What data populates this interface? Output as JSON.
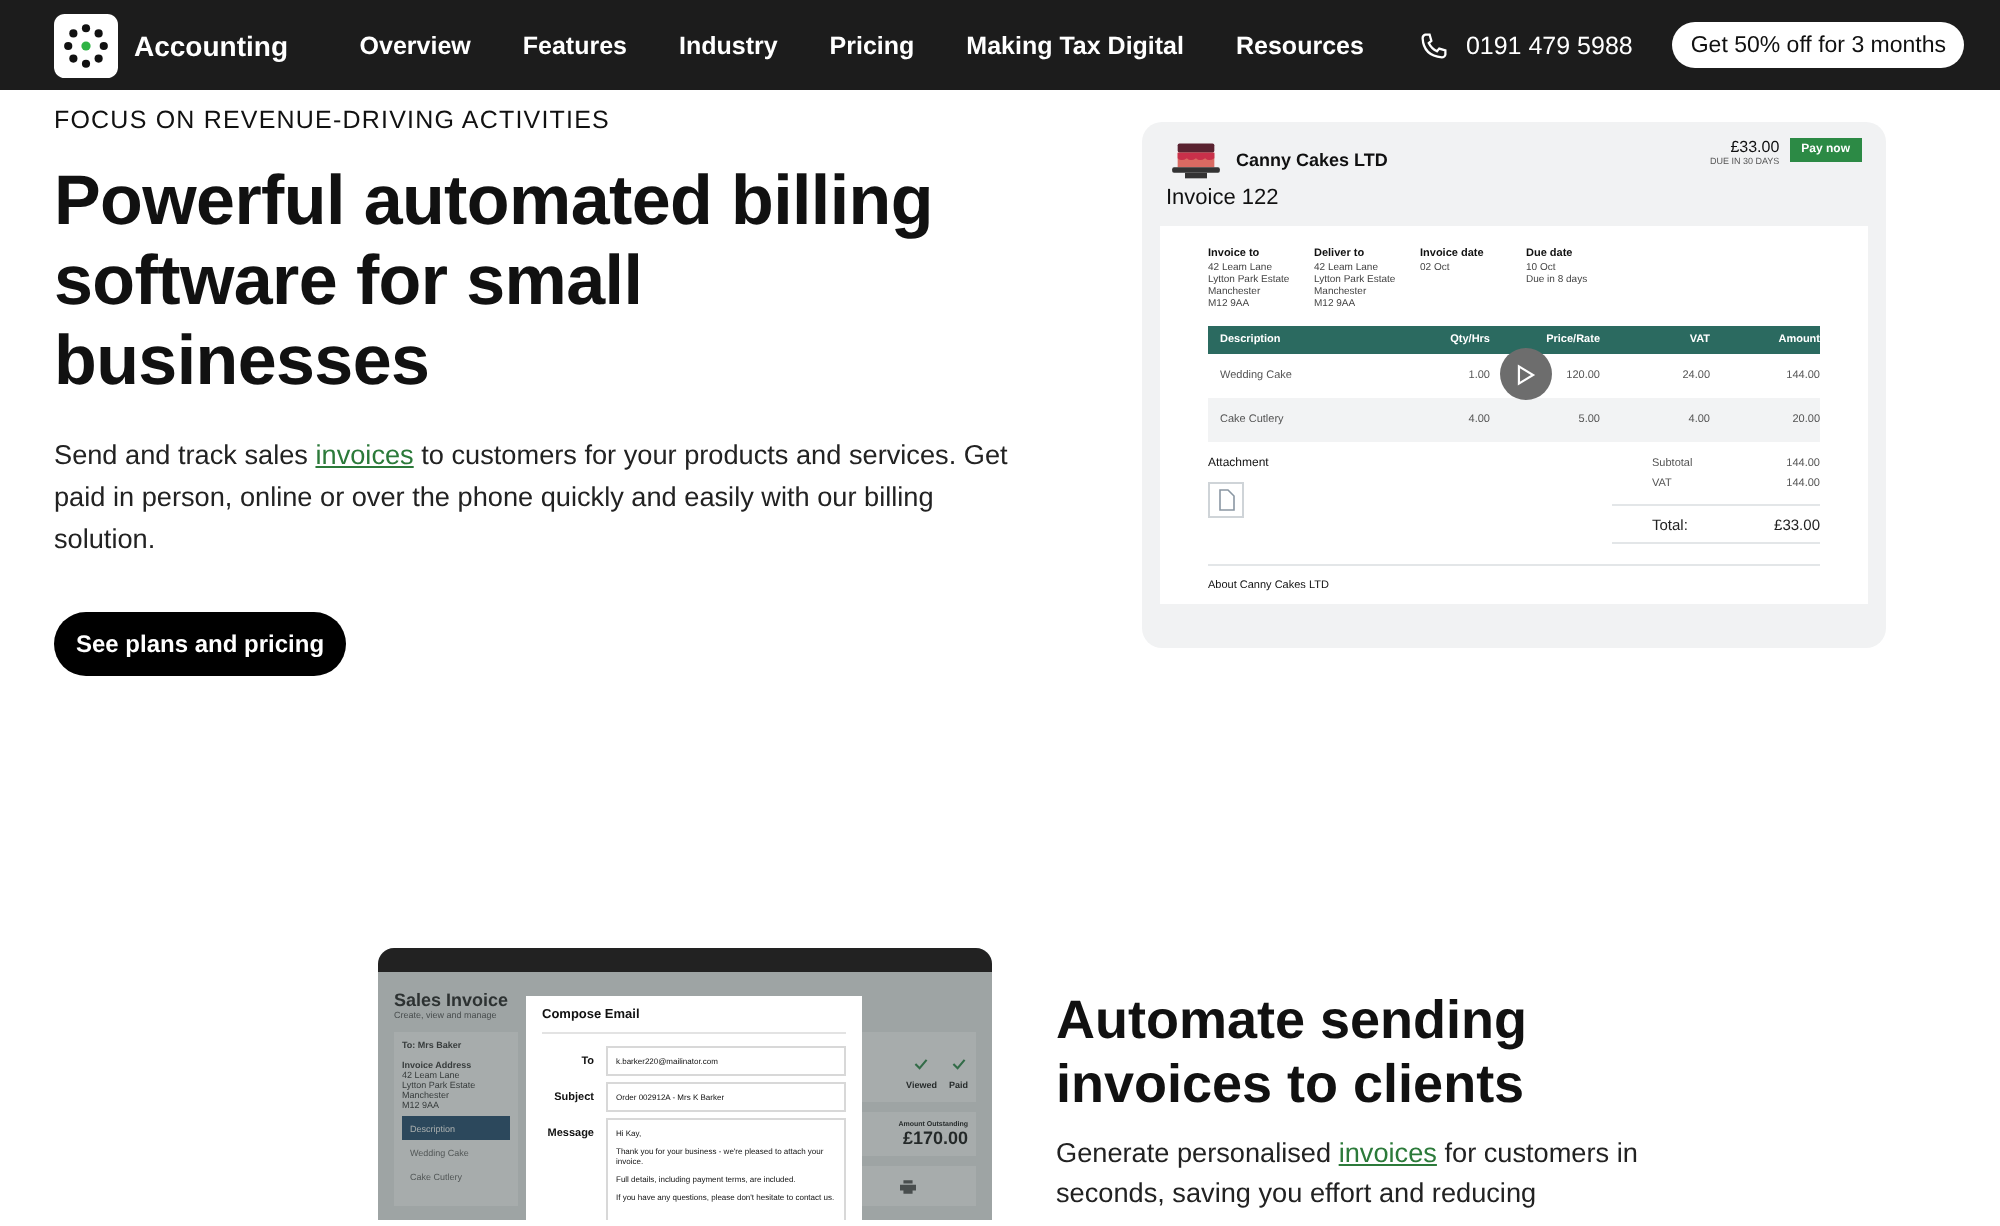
{
  "nav": {
    "brand": "Accounting",
    "links": [
      "Overview",
      "Features",
      "Industry",
      "Pricing",
      "Making Tax Digital",
      "Resources"
    ],
    "phone": "0191 479 5988",
    "cta": "Get 50% off for 3 months"
  },
  "hero": {
    "eyebrow": "FOCUS ON REVENUE-DRIVING ACTIVITIES",
    "heading": "Powerful automated billing software for small businesses",
    "text_before": "Send and track sales ",
    "link": "invoices",
    "text_after": " to customers for your products and services. Get paid in person, online or over the phone quickly and easily with our billing solution.",
    "button": "See plans and pricing"
  },
  "invoice": {
    "company": "Canny Cakes LTD",
    "amount": "£33.00",
    "due_note": "DUE IN 30 DAYS",
    "pay_button": "Pay now",
    "title": "Invoice 122",
    "details": [
      {
        "label": "Invoice to",
        "lines": [
          "42 Leam Lane",
          "Lytton Park Estate",
          "Manchester",
          "M12 9AA"
        ]
      },
      {
        "label": "Deliver to",
        "lines": [
          "42 Leam Lane",
          "Lytton Park Estate",
          "Manchester",
          "M12 9AA"
        ]
      },
      {
        "label": "Invoice date",
        "lines": [
          "02 Oct"
        ]
      },
      {
        "label": "Due date",
        "lines": [
          "10 Oct",
          "Due in 8 days"
        ]
      }
    ],
    "columns": [
      "Description",
      "Qty/Hrs",
      "Price/Rate",
      "VAT",
      "Amount"
    ],
    "rows": [
      [
        "Wedding Cake",
        "1.00",
        "120.00",
        "24.00",
        "144.00"
      ],
      [
        "Cake Cutlery",
        "4.00",
        "5.00",
        "4.00",
        "20.00"
      ]
    ],
    "attachment_label": "Attachment",
    "totals": [
      {
        "label": "Subtotal",
        "value": "144.00"
      },
      {
        "label": "VAT",
        "value": "144.00"
      }
    ],
    "total": {
      "label": "Total:",
      "value": "£33.00"
    },
    "about": "About Canny Cakes LTD"
  },
  "feature": {
    "mockup": {
      "title": "Sales Invoice",
      "subtitle": "Create, view and manage",
      "to": "To: Mrs Baker",
      "address_label": "Invoice Address",
      "address": [
        "42 Leam Lane",
        "Lytton Park Estate",
        "Manchester",
        "M12 9AA"
      ],
      "items": [
        {
          "label": "Description",
          "selected": true
        },
        {
          "label": "Wedding Cake",
          "selected": false
        },
        {
          "label": "Cake Cutlery",
          "selected": false
        }
      ],
      "statuses": [
        "Viewed",
        "Paid"
      ],
      "outstanding_label": "Amount Outstanding",
      "outstanding": "£170.00",
      "modal": {
        "title": "Compose Email",
        "fields": [
          {
            "label": "To",
            "value": "k.barker220@mailinator.com"
          },
          {
            "label": "Subject",
            "value": "Order 002912A - Mrs K Barker"
          }
        ],
        "message_label": "Message",
        "message": [
          "Hi Kay,",
          "Thank you for your business - we're pleased to attach your invoice.",
          "Full details, including payment terms, are included.",
          "If you have any questions, please don't hesitate to contact us."
        ]
      }
    },
    "heading": "Automate sending invoices to clients",
    "text_before": "Generate personalised ",
    "link": "invoices",
    "text_after": " for customers in seconds, saving you effort and reducing"
  }
}
